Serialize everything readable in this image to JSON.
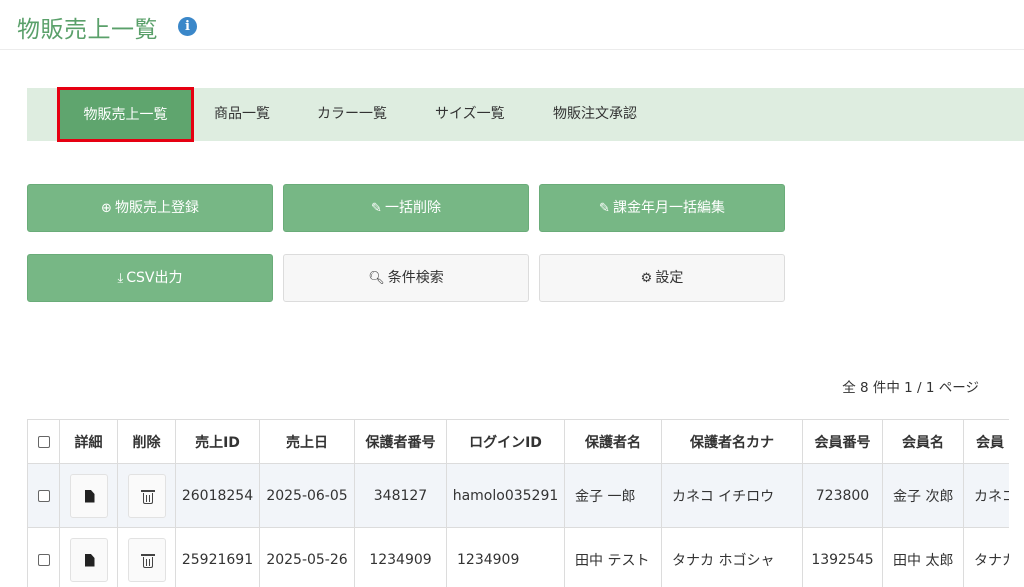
{
  "page": {
    "title": "物販売上一覧",
    "info_icon": "info-circle-icon"
  },
  "tabs": [
    {
      "label": "物販売上一覧",
      "active": true
    },
    {
      "label": "商品一覧"
    },
    {
      "label": "カラー一覧"
    },
    {
      "label": "サイズ一覧"
    },
    {
      "label": "物販注文承認"
    }
  ],
  "actions": {
    "register": {
      "label": "物販売上登録",
      "icon": "plus-circle-icon"
    },
    "bulk_delete": {
      "label": "一括削除",
      "icon": "pencil-icon"
    },
    "bulk_edit_month": {
      "label": "課金年月一括編集",
      "icon": "pencil-icon"
    },
    "csv_export": {
      "label": "CSV出力",
      "icon": "download-icon"
    },
    "search": {
      "label": "条件検索",
      "icon": "search-icon"
    },
    "settings": {
      "label": "設定",
      "icon": "gear-icon"
    }
  },
  "pagination": {
    "summary": "全 8 件中 1 / 1 ページ"
  },
  "table": {
    "columns": [
      "詳細",
      "削除",
      "売上ID",
      "売上日",
      "保護者番号",
      "ログインID",
      "保護者名",
      "保護者名カナ",
      "会員番号",
      "会員名",
      "会員"
    ],
    "rows": [
      {
        "sales_id": "26018254",
        "date": "2025-06-05",
        "guardian_no": "348127",
        "login_id": "hamolo035291",
        "guardian_name": "金子 一郎",
        "guardian_kana": "カネコ イチロウ",
        "member_no": "723800",
        "member_name": "金子 次郎",
        "member_kana": "カネコ"
      },
      {
        "sales_id": "25921691",
        "date": "2025-05-26",
        "guardian_no": "1234909",
        "login_id": "1234909",
        "guardian_name": "田中 テスト",
        "guardian_kana": "タナカ ホゴシャ",
        "member_no": "1392545",
        "member_name": "田中 太郎",
        "member_kana": "タナカ"
      }
    ]
  },
  "colors": {
    "accent": "#77b785",
    "title": "#5aa06a",
    "tab_bar": "#deede0",
    "highlight": "#e60012"
  }
}
